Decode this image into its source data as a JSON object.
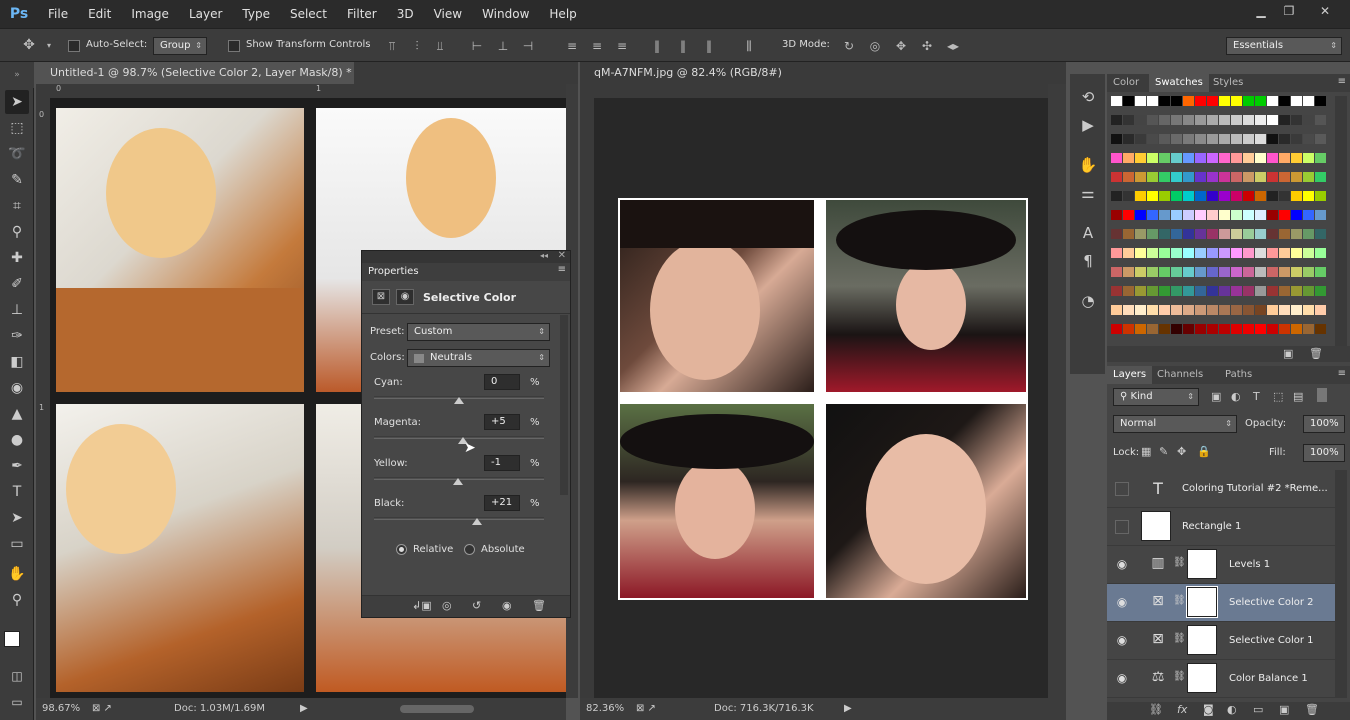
{
  "app": {
    "logo": "Ps"
  },
  "menu": [
    "File",
    "Edit",
    "Image",
    "Layer",
    "Type",
    "Select",
    "Filter",
    "3D",
    "View",
    "Window",
    "Help"
  ],
  "window_controls": {
    "minimize": "▁",
    "restore": "❐",
    "close": "✕"
  },
  "options": {
    "auto_select_label": "Auto-Select:",
    "auto_select_value": "Group",
    "transform_label": "Show Transform Controls",
    "mode_3d_label": "3D Mode:",
    "workspace": "Essentials"
  },
  "tabs": {
    "left": "Untitled-1 @ 98.7% (Selective Color 2, Layer Mask/8) *",
    "right": "qM-A7NFM.jpg @ 82.4% (RGB/8#)",
    "close": "×"
  },
  "ruler": {
    "left_zero": "0",
    "left_one": "1",
    "v_zero": "0",
    "v_one": "1"
  },
  "status": {
    "left_zoom": "98.67%",
    "left_doc": "Doc: 1.03M/1.69M",
    "right_zoom": "82.36%",
    "right_doc": "Doc: 716.3K/716.3K"
  },
  "properties": {
    "title": "Properties",
    "adjustment": "Selective Color",
    "preset_label": "Preset:",
    "preset_value": "Custom",
    "colors_label": "Colors:",
    "colors_value": "Neutrals",
    "percent": "%",
    "sliders": [
      {
        "label": "Cyan:",
        "value": "0",
        "pos": 0.5
      },
      {
        "label": "Magenta:",
        "value": "+5",
        "pos": 0.525
      },
      {
        "label": "Yellow:",
        "value": "-1",
        "pos": 0.495
      },
      {
        "label": "Black:",
        "value": "+21",
        "pos": 0.605
      }
    ],
    "relative_label": "Relative",
    "absolute_label": "Absolute",
    "method_selected": "Relative"
  },
  "panels": {
    "color_tab": "Color",
    "swatches_tab": "Swatches",
    "styles_tab": "Styles",
    "layers_tab": "Layers",
    "channels_tab": "Channels",
    "paths_tab": "Paths",
    "kind_value": "Kind",
    "blend_mode": "Normal",
    "opacity_label": "Opacity:",
    "opacity_value": "100%",
    "lock_label": "Lock:",
    "fill_label": "Fill:",
    "fill_value": "100%"
  },
  "layers": [
    {
      "name": "Coloring Tutorial #2 *Reme...",
      "type": "text",
      "visible": false
    },
    {
      "name": "Rectangle 1",
      "type": "shape",
      "visible": false
    },
    {
      "name": "Levels 1",
      "type": "levels",
      "visible": true
    },
    {
      "name": "Selective Color 2",
      "type": "selective",
      "visible": true,
      "selected": true
    },
    {
      "name": "Selective Color 1",
      "type": "selective",
      "visible": true
    },
    {
      "name": "Color Balance 1",
      "type": "balance",
      "visible": true
    }
  ]
}
